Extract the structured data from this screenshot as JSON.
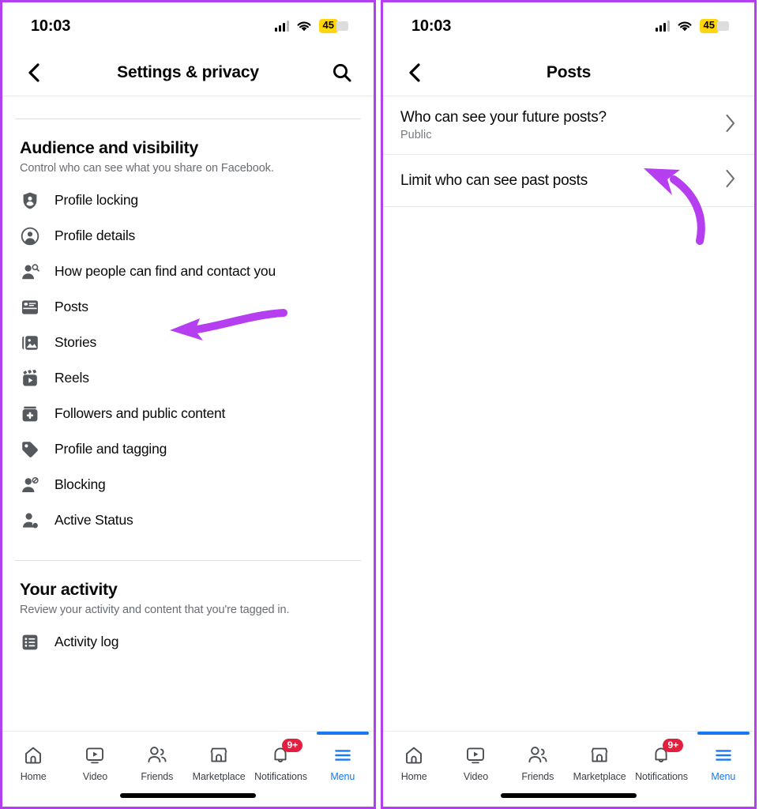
{
  "accent_purple": "#b43ef0",
  "brand_blue": "#1878f3",
  "badge_red": "#e41e3f",
  "battery_yellow": "#ffd60a",
  "left_phone": {
    "status": {
      "time": "10:03",
      "battery": "45",
      "signal_icon": "signal-bars-icon",
      "wifi_icon": "wifi-icon"
    },
    "header": {
      "back_icon": "back-chevron-icon",
      "title": "Settings & privacy",
      "search_icon": "search-icon"
    },
    "sections": [
      {
        "title": "Audience and visibility",
        "subtitle": "Control who can see what you share on Facebook.",
        "items": [
          {
            "label": "Profile locking",
            "icon": "shield-person-icon"
          },
          {
            "label": "Profile details",
            "icon": "account-circle-icon"
          },
          {
            "label": "How people can find and contact you",
            "icon": "person-search-icon"
          },
          {
            "label": "Posts",
            "icon": "posts-card-icon"
          },
          {
            "label": "Stories",
            "icon": "stories-photo-icon"
          },
          {
            "label": "Reels",
            "icon": "reels-clapper-icon"
          },
          {
            "label": "Followers and public content",
            "icon": "followers-add-icon"
          },
          {
            "label": "Profile and tagging",
            "icon": "tag-icon"
          },
          {
            "label": "Blocking",
            "icon": "person-block-icon"
          },
          {
            "label": "Active Status",
            "icon": "person-active-dot-icon"
          }
        ]
      },
      {
        "title": "Your activity",
        "subtitle": "Review your activity and content that you're tagged in.",
        "items": [
          {
            "label": "Activity log",
            "icon": "activity-list-icon"
          }
        ]
      }
    ],
    "tabs": [
      {
        "label": "Home",
        "icon": "home-icon",
        "active": false,
        "badge": ""
      },
      {
        "label": "Video",
        "icon": "video-icon",
        "active": false,
        "badge": ""
      },
      {
        "label": "Friends",
        "icon": "friends-icon",
        "active": false,
        "badge": ""
      },
      {
        "label": "Marketplace",
        "icon": "marketplace-icon",
        "active": false,
        "badge": ""
      },
      {
        "label": "Notifications",
        "icon": "bell-icon",
        "active": false,
        "badge": "9+"
      },
      {
        "label": "Menu",
        "icon": "hamburger-menu-icon",
        "active": true,
        "badge": ""
      }
    ]
  },
  "right_phone": {
    "status": {
      "time": "10:03",
      "battery": "45",
      "signal_icon": "signal-bars-icon",
      "wifi_icon": "wifi-icon"
    },
    "header": {
      "back_icon": "back-chevron-icon",
      "title": "Posts"
    },
    "rows": [
      {
        "title": "Who can see your future posts?",
        "value": "Public",
        "chevron": "chevron-right-icon"
      },
      {
        "title": "Limit who can see past posts",
        "value": "",
        "chevron": "chevron-right-icon"
      }
    ],
    "tabs": [
      {
        "label": "Home",
        "icon": "home-icon",
        "active": false,
        "badge": ""
      },
      {
        "label": "Video",
        "icon": "video-icon",
        "active": false,
        "badge": ""
      },
      {
        "label": "Friends",
        "icon": "friends-icon",
        "active": false,
        "badge": ""
      },
      {
        "label": "Marketplace",
        "icon": "marketplace-icon",
        "active": false,
        "badge": ""
      },
      {
        "label": "Notifications",
        "icon": "bell-icon",
        "active": false,
        "badge": "9+"
      },
      {
        "label": "Menu",
        "icon": "hamburger-menu-icon",
        "active": true,
        "badge": ""
      }
    ]
  },
  "annotations": [
    {
      "name": "arrow-pointing-to-posts",
      "color": "#b43ef0"
    },
    {
      "name": "arrow-pointing-to-limit-past-posts",
      "color": "#b43ef0"
    }
  ]
}
